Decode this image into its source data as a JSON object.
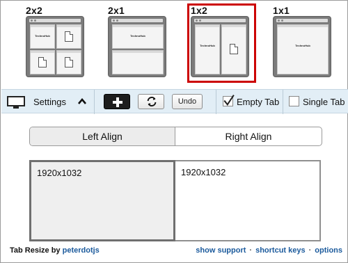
{
  "layouts": [
    {
      "label": "2x2",
      "brand": "TechnoHub"
    },
    {
      "label": "2x1",
      "brand": "TechnoHub"
    },
    {
      "label": "1x2",
      "brand": "TechnoHub",
      "selected": true
    },
    {
      "label": "1x1",
      "brand": "TechnoHub"
    }
  ],
  "toolbar": {
    "settings_label": "Settings",
    "add_icon": "plus-icon",
    "refresh_icon": "refresh-icon",
    "undo_label": "Undo",
    "empty_tab_label": "Empty Tab",
    "empty_tab_checked": true,
    "single_tab_label": "Single Tab",
    "single_tab_checked": false
  },
  "align": {
    "left_label": "Left Align",
    "right_label": "Right Align",
    "selected": "left"
  },
  "panes": [
    {
      "resolution": "1920x1032",
      "selected": true
    },
    {
      "resolution": "1920x1032",
      "selected": false
    }
  ],
  "footer": {
    "prefix": "Tab Resize by",
    "author": "peterdotjs",
    "links": [
      "show support",
      "shortcut keys",
      "options"
    ]
  },
  "colors": {
    "selection": "#cc0000",
    "toolbar_bg": "#e2eef6",
    "link": "#1b5a9c"
  }
}
